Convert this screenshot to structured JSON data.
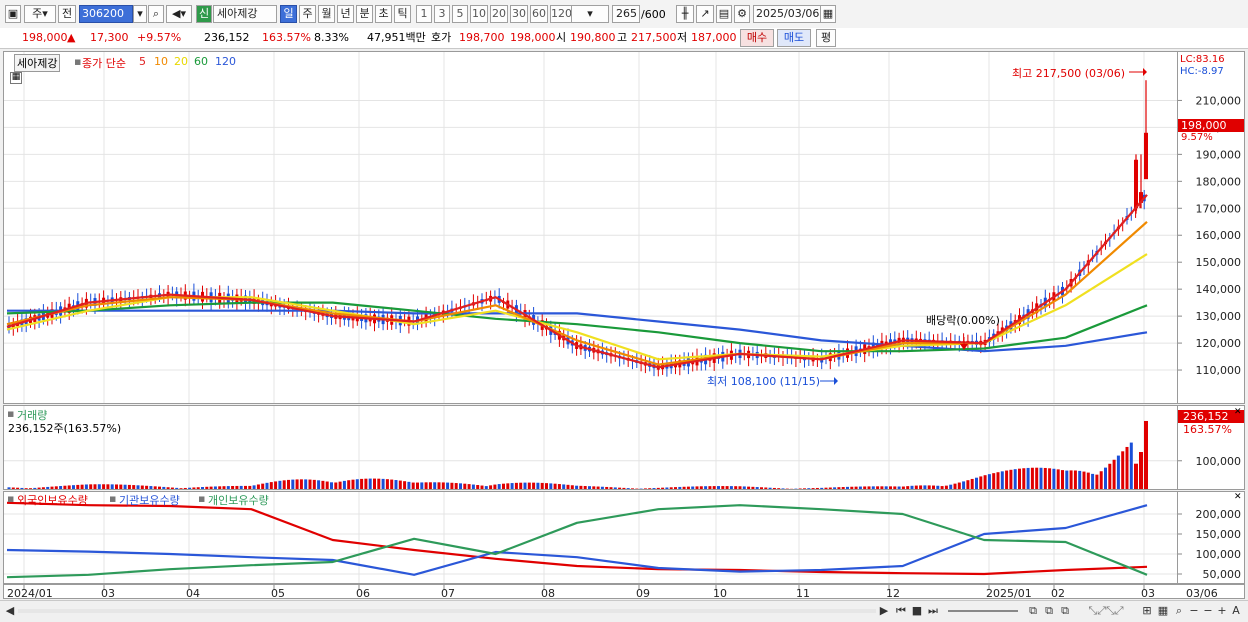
{
  "toolbar": {
    "market_label": "주",
    "prev_label": "전",
    "code": "306200",
    "new_badge": "신",
    "stock_name": "세아제강",
    "period_tabs": [
      "일",
      "주",
      "월",
      "년",
      "분",
      "초",
      "틱"
    ],
    "active_period": "일",
    "intervals": [
      "1",
      "3",
      "5",
      "10",
      "20",
      "30",
      "60",
      "120"
    ],
    "count_value": "265",
    "count_max": "/600",
    "date": "2025/03/06"
  },
  "quote": {
    "price": "198,000",
    "change": "17,300",
    "change_pct": "+9.57%",
    "volume": "236,152",
    "volume_ratio": "163.57%",
    "turnover": "8.33%",
    "amount": "47,951백만",
    "ask_label": "호가",
    "ask1": "198,700",
    "ask2": "198,000",
    "open_label": "시",
    "open": "190,800",
    "high_label": "고",
    "high": "217,500",
    "low_label": "저",
    "low": "187,000",
    "buy_label": "매수",
    "sell_label": "매도",
    "avg_label": "평"
  },
  "price_panel": {
    "stock_tag": "세아제강",
    "legend": {
      "close_label": "종가 단순",
      "ma_periods": [
        "5",
        "10",
        "20",
        "60",
        "120"
      ]
    },
    "lc": "LC:83.16",
    "hc": "HC:-8.97",
    "high_note": "최고 217,500 (03/06)",
    "low_note": "최저 108,100 (11/15)",
    "dividend_note": "배당락(0.00%)",
    "last_price_tag": "198,000",
    "last_pct_tag": "9.57%"
  },
  "volume_panel": {
    "title": "거래량",
    "value_text": "236,152주(163.57%)",
    "tag_value": "236,152",
    "tag_pct": "163.57%"
  },
  "holdings_panel": {
    "legend": [
      "외국인보유수량",
      "기관보유수량",
      "개인보유수량"
    ]
  },
  "x_axis": {
    "labels": [
      "2024/01",
      "03",
      "04",
      "05",
      "06",
      "07",
      "08",
      "09",
      "10",
      "11",
      "12",
      "2025/01",
      "02",
      "03"
    ],
    "end_label": "03/06"
  },
  "colors": {
    "up": "#e00000",
    "down": "#1a4fd8",
    "ma5": "#e02020",
    "ma10": "#f08a00",
    "ma20": "#f0e020",
    "ma60": "#1a9a3a",
    "ma120": "#2b57d8",
    "foreign": "#e00000",
    "institution": "#2b57d8",
    "individual": "#2e9a5a"
  },
  "chart_data": [
    {
      "type": "line",
      "title": "세아제강",
      "ylim": [
        100000,
        225000
      ],
      "y_ticks": [
        110000,
        120000,
        130000,
        140000,
        150000,
        160000,
        170000,
        180000,
        190000,
        200000,
        210000
      ],
      "x": [
        "2024/01",
        "03",
        "04",
        "05",
        "06",
        "07",
        "08",
        "09",
        "10",
        "11",
        "12",
        "2025/01",
        "02",
        "03",
        "03/06"
      ],
      "series": [
        {
          "name": "5",
          "values": [
            126000,
            135000,
            138000,
            136000,
            130000,
            128000,
            137000,
            119000,
            111000,
            116000,
            114000,
            121000,
            120000,
            140000,
            175000
          ]
        },
        {
          "name": "10",
          "values": [
            127000,
            134000,
            137000,
            136000,
            131000,
            128000,
            134000,
            121000,
            112000,
            116000,
            114000,
            120000,
            120000,
            138000,
            165000
          ]
        },
        {
          "name": "20",
          "values": [
            125000,
            132000,
            137000,
            137000,
            132000,
            127000,
            132000,
            124000,
            114000,
            116000,
            115000,
            119000,
            120000,
            134000,
            153000
          ]
        },
        {
          "name": "60",
          "values": [
            131000,
            132000,
            134000,
            135000,
            135000,
            132000,
            129000,
            127000,
            124000,
            120000,
            117000,
            117000,
            118000,
            122000,
            134000
          ]
        },
        {
          "name": "120",
          "values": [
            132000,
            132000,
            132000,
            132000,
            132000,
            131000,
            131000,
            131000,
            128000,
            125000,
            121000,
            119000,
            117000,
            119000,
            124000
          ]
        }
      ]
    },
    {
      "type": "bar",
      "title": "거래량",
      "ylim": [
        0,
        260000
      ],
      "y_ticks": [
        100000
      ],
      "x": [
        "2024/01",
        "03",
        "04",
        "05",
        "06",
        "07",
        "08",
        "09",
        "10",
        "11",
        "12",
        "2025/01",
        "02",
        "03",
        "03/06"
      ],
      "values": [
        15000,
        20000,
        18000,
        14000,
        70000,
        25000,
        40000,
        15000,
        12000,
        14000,
        10000,
        14000,
        60000,
        90000,
        236152
      ]
    },
    {
      "type": "line",
      "title": "보유수량",
      "ylim": [
        30000,
        240000
      ],
      "y_ticks": [
        50000,
        100000,
        150000,
        200000
      ],
      "x": [
        "2024/01",
        "03",
        "04",
        "05",
        "06",
        "07",
        "08",
        "09",
        "10",
        "11",
        "12",
        "2025/01",
        "02",
        "03",
        "03/06"
      ],
      "series": [
        {
          "name": "외국인보유수량",
          "values": [
            228000,
            222000,
            220000,
            212000,
            135000,
            110000,
            88000,
            70000,
            62000,
            60000,
            55000,
            52000,
            50000,
            60000,
            68000
          ]
        },
        {
          "name": "기관보유수량",
          "values": [
            110000,
            106000,
            100000,
            92000,
            85000,
            48000,
            105000,
            92000,
            65000,
            56000,
            60000,
            70000,
            150000,
            165000,
            222000
          ]
        },
        {
          "name": "개인보유수량",
          "values": [
            42000,
            48000,
            62000,
            72000,
            80000,
            138000,
            100000,
            178000,
            212000,
            222000,
            212000,
            200000,
            135000,
            130000,
            48000
          ]
        }
      ]
    }
  ]
}
